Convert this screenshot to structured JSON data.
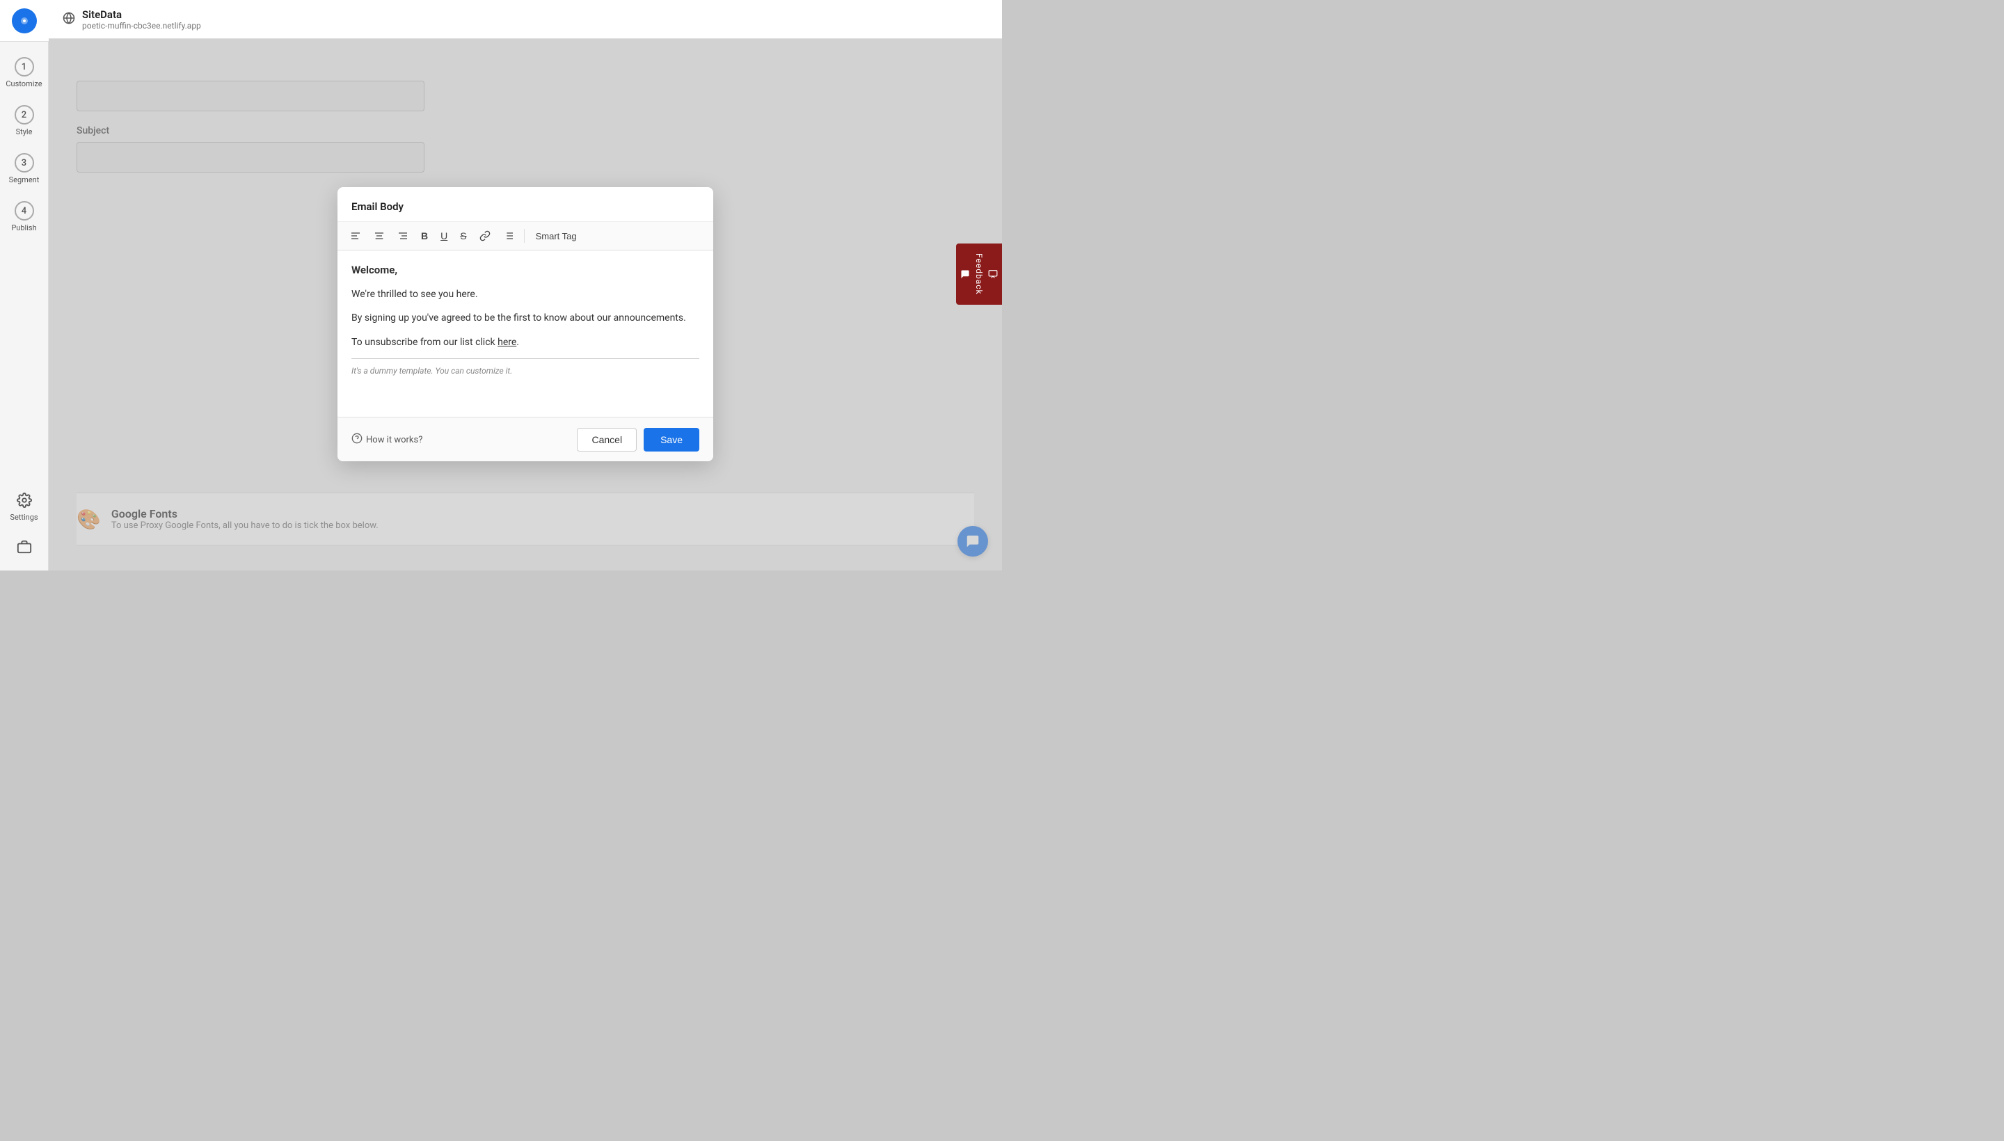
{
  "app": {
    "logo_char": "●",
    "site_name": "SiteData",
    "site_url": "poetic-muffin-cbc3ee.netlify.app"
  },
  "sidebar": {
    "items": [
      {
        "step": "1",
        "label": "Customize"
      },
      {
        "step": "2",
        "label": "Style"
      },
      {
        "step": "3",
        "label": "Segment"
      },
      {
        "step": "4",
        "label": "Publish"
      }
    ],
    "settings_label": "Settings",
    "bottom_icon_label": ""
  },
  "background_form": {
    "subject_label": "Subject"
  },
  "modal": {
    "title": "Email Body",
    "toolbar": {
      "align_left": "≡",
      "align_center": "≡",
      "align_right": "≡",
      "bold": "B",
      "underline": "U",
      "strikethrough": "S̶",
      "link": "🔗",
      "list": "≡",
      "smart_tag": "Smart Tag"
    },
    "content": {
      "welcome": "Welcome,",
      "line1": "We're thrilled to see you here.",
      "line2": "By signing up you've agreed to be the first to know about our announcements.",
      "line3_prefix": "To unsubscribe from our list click ",
      "line3_link": "here",
      "line3_suffix": ".",
      "footer_italic": "It's a dummy template. You can customize it."
    },
    "how_it_works": "How it works?",
    "cancel_label": "Cancel",
    "save_label": "Save"
  },
  "google_fonts": {
    "icon": "🎨",
    "title": "Google Fonts",
    "description": "To use Proxy Google Fonts, all you have to do is tick the box below."
  },
  "feedback": {
    "label": "Feedback"
  },
  "chat": {
    "icon": "💬"
  }
}
